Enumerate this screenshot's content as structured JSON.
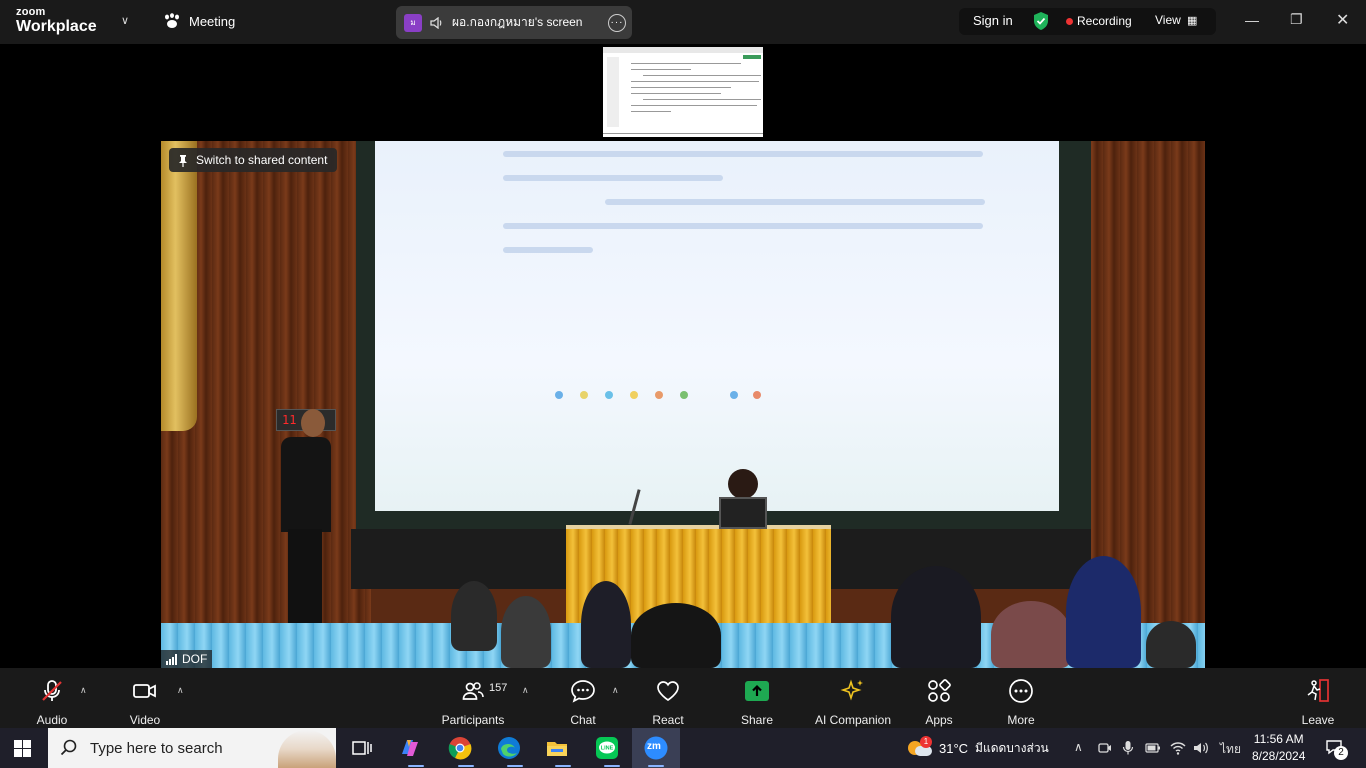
{
  "header": {
    "logo_top": "zoom",
    "logo_bottom": "Workplace",
    "meeting_label": "Meeting",
    "share_avatar": "ม",
    "share_name": "ผอ.กองกฎหมาย's screen",
    "signin_label": "Sign in",
    "recording_label": "Recording",
    "view_label": "View"
  },
  "video": {
    "switch_label": "Switch to shared content",
    "participant_name": "DOF",
    "clock_display": "11 0"
  },
  "toolbar": {
    "audio_label": "Audio",
    "video_label": "Video",
    "participants_label": "Participants",
    "participants_count": "157",
    "chat_label": "Chat",
    "react_label": "React",
    "share_label": "Share",
    "ai_label": "AI Companion",
    "apps_label": "Apps",
    "more_label": "More",
    "leave_label": "Leave"
  },
  "taskbar": {
    "search_placeholder": "Type here to search",
    "weather_badge": "1",
    "temperature": "31°C",
    "weather_text": "มีแดดบางส่วน",
    "language": "ไทย",
    "time": "11:56 AM",
    "date": "8/28/2024",
    "notification_count": "2",
    "zoom_app_label": "zm"
  },
  "colors": {
    "share_green": "#1ea952",
    "recording_red": "#e33333",
    "shield_green": "#1fb35a"
  }
}
